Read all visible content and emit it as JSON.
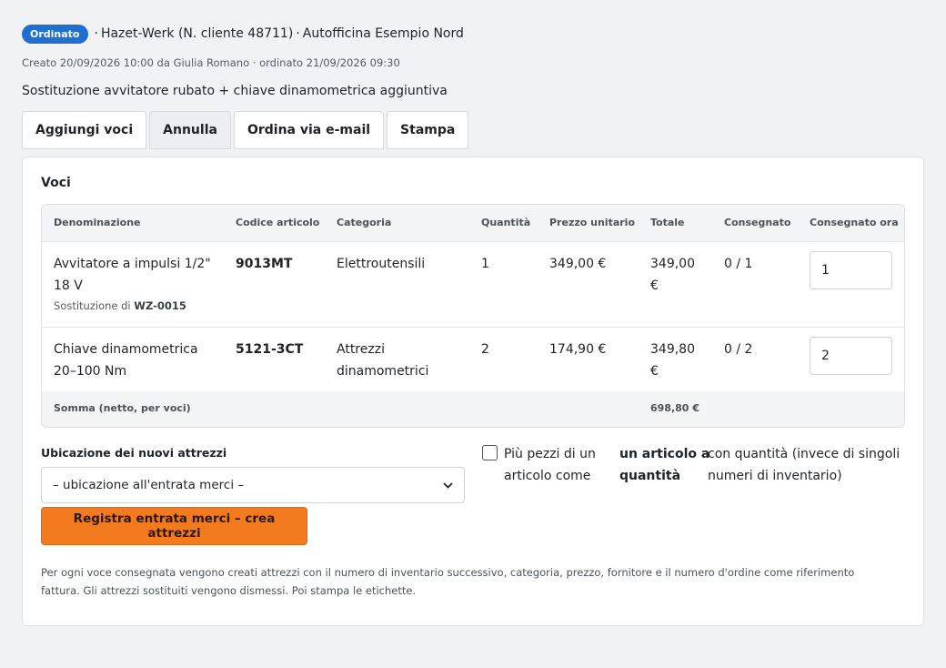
{
  "header": {
    "status": "Ordinato",
    "supplier": "Hazet-Werk (N. cliente 48711)",
    "workshop": "Autofficina Esempio Nord",
    "separator": "·"
  },
  "meta": "Creato 20/09/2026 10:00 da Giulia Romano · ordinato 21/09/2026 09:30",
  "description": "Sostituzione avvitatore rubato + chiave dinamometrica aggiuntiva",
  "toolbar": {
    "add": "Aggiungi voci",
    "cancel": "Annulla",
    "email": "Ordina via e-mail",
    "print": "Stampa"
  },
  "items_title": "Voci",
  "columns": {
    "name": "Denominazione",
    "code": "Codice articolo",
    "category": "Categoria",
    "qty": "Quantità",
    "unit_price": "Prezzo unitario",
    "total": "Totale",
    "delivered": "Consegnato",
    "delivered_now": "Consegnato ora"
  },
  "rows": [
    {
      "name_l1": "Avvitatore a impulsi 1/2\"",
      "name_l2": "18 V",
      "sub_prefix": "Sostituzione di",
      "sub_ref": "WZ-0015",
      "code": "9013MT",
      "category_l1": "Elettroutensili",
      "category_l2": "",
      "qty": "1",
      "unit_price": "349,00 €",
      "total_l1": "349,00",
      "total_l2": "€",
      "delivered": "0 / 1",
      "delivered_now": "1"
    },
    {
      "name_l1": "Chiave dinamometrica",
      "name_l2": "20–100 Nm",
      "sub_prefix": "",
      "sub_ref": "",
      "code": "5121-3CT",
      "category_l1": "Attrezzi",
      "category_l2": "dinamometrici",
      "qty": "2",
      "unit_price": "174,90 €",
      "total_l1": "349,80",
      "total_l2": "€",
      "delivered": "0 / 2",
      "delivered_now": "2"
    }
  ],
  "sum": {
    "label": "Somma (netto, per voci)",
    "value": "698,80 €"
  },
  "location": {
    "label": "Ubicazione dei nuovi attrezzi",
    "selected": "– ubicazione all'entrata merci –"
  },
  "checkbox": {
    "col1_l1": "Più pezzi di un",
    "col1_l2": "articolo come",
    "col2_l1": "un articolo a",
    "col2_l2": "quantità",
    "col3_l1": "con quantità (invece di singoli",
    "col3_l2": "numeri di inventario)"
  },
  "primary_button": "Registra entrata merci – crea attrezzi",
  "note_l1": "Per ogni voce consegnata vengono creati attrezzi con il numero di inventario successivo, categoria, prezzo, fornitore e il numero d'ordine come riferimento",
  "note_l2": "fattura. Gli attrezzi sostituiti vengono dismessi. Poi stampa le etichette.",
  "colors": {
    "badge": "#1f6fd1",
    "primary": "#f47a20"
  }
}
